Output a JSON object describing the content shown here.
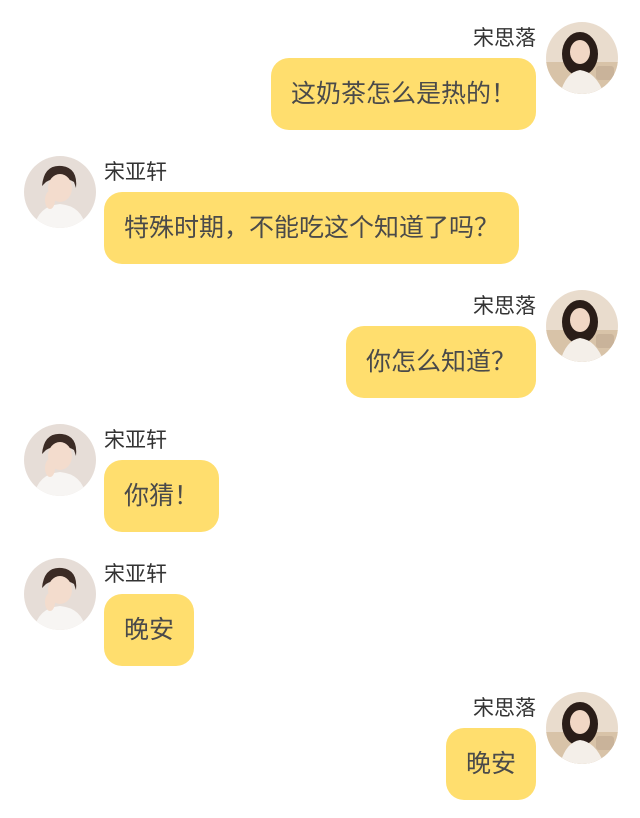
{
  "messages": [
    {
      "side": "self",
      "sender": "宋思落",
      "text": "这奶茶怎么是热的！",
      "avatar": "female-avatar"
    },
    {
      "side": "other",
      "sender": "宋亚轩",
      "text": "特殊时期，不能吃这个知道了吗？",
      "avatar": "male-avatar"
    },
    {
      "side": "self",
      "sender": "宋思落",
      "text": "你怎么知道？",
      "avatar": "female-avatar"
    },
    {
      "side": "other",
      "sender": "宋亚轩",
      "text": "你猜！",
      "avatar": "male-avatar"
    },
    {
      "side": "other",
      "sender": "宋亚轩",
      "text": "晚安",
      "avatar": "male-avatar"
    },
    {
      "side": "self",
      "sender": "宋思落",
      "text": "晚安",
      "avatar": "female-avatar"
    }
  ],
  "colors": {
    "bubble": "#ffde6e",
    "bubble_text": "#4a4a4a",
    "name_text": "#333333"
  }
}
